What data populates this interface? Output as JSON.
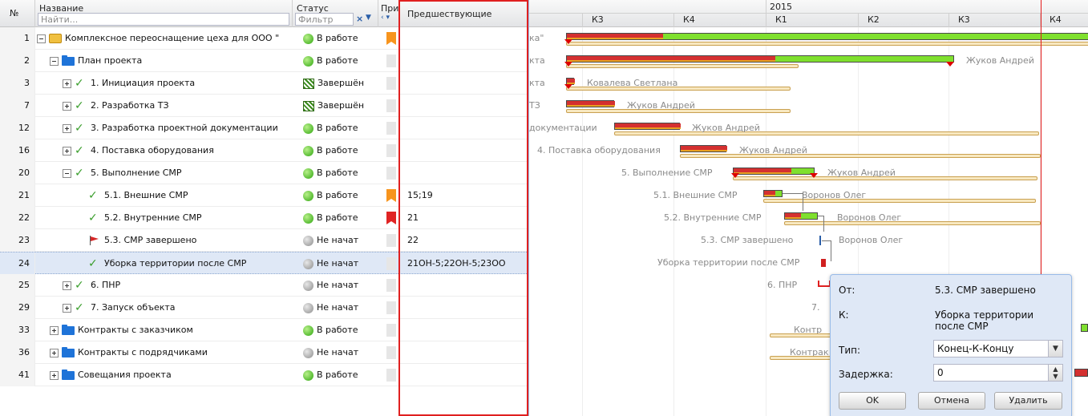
{
  "columns": {
    "num": "№",
    "name": "Название",
    "name_filter": "Найти...",
    "status": "Статус",
    "status_filter": "Фильтр",
    "priority": "При",
    "predecessors": "Предшествующие"
  },
  "timeline": {
    "year": "2015",
    "quarters": [
      "К3",
      "К4",
      "К1",
      "К2",
      "К3",
      "К4"
    ]
  },
  "rows": [
    {
      "num": "1",
      "name": "Комплексное переоснащение цеха для ООО \"",
      "status": "В работе",
      "pred": ""
    },
    {
      "num": "2",
      "name": "План проекта",
      "status": "В работе",
      "pred": ""
    },
    {
      "num": "3",
      "name": "1. Инициация проекта",
      "status": "Завершён",
      "pred": ""
    },
    {
      "num": "7",
      "name": "2. Разработка ТЗ",
      "status": "Завершён",
      "pred": ""
    },
    {
      "num": "12",
      "name": "3. Разработка проектной документации",
      "status": "В работе",
      "pred": ""
    },
    {
      "num": "16",
      "name": "4. Поставка оборудования",
      "status": "В работе",
      "pred": ""
    },
    {
      "num": "20",
      "name": "5. Выполнение СМР",
      "status": "В работе",
      "pred": ""
    },
    {
      "num": "21",
      "name": "5.1. Внешние СМР",
      "status": "В работе",
      "pred": "15;19"
    },
    {
      "num": "22",
      "name": "5.2. Внутренние СМР",
      "status": "В работе",
      "pred": "21"
    },
    {
      "num": "23",
      "name": "5.3. СМР завершено",
      "status": "Не начат",
      "pred": "22"
    },
    {
      "num": "24",
      "name": "Уборка территории после СМР",
      "status": "Не начат",
      "pred": "21ОН-5;22ОН-5;23ОО"
    },
    {
      "num": "25",
      "name": "6. ПНР",
      "status": "Не начат",
      "pred": ""
    },
    {
      "num": "29",
      "name": "7. Запуск объекта",
      "status": "Не начат",
      "pred": ""
    },
    {
      "num": "33",
      "name": "Контракты с заказчиком",
      "status": "В работе",
      "pred": ""
    },
    {
      "num": "36",
      "name": "Контракты с подрядчиками",
      "status": "Не начат",
      "pred": ""
    },
    {
      "num": "41",
      "name": "Совещания проекта",
      "status": "В работе",
      "pred": ""
    }
  ],
  "gantt_labels": {
    "r1_left": "ка\"",
    "r2_left": "кта",
    "r2_res": "Жуков Андрей",
    "r3_left": "кта",
    "r3_res": "Ковалева Светлана",
    "r7_left": "ТЗ",
    "r7_res": "Жуков Андрей",
    "r12_left": "документации",
    "r12_res": "Жуков Андрей",
    "r16_left": "4. Поставка оборудования",
    "r16_res": "Жуков Андрей",
    "r20_left": "5. Выполнение СМР",
    "r20_res": "Жуков Андрей",
    "r21_left": "5.1. Внешние СМР",
    "r21_res": "Воронов Олег",
    "r22_left": "5.2. Внутренние СМР",
    "r22_res": "Воронов Олег",
    "r23_left": "5.3. СМР завершено",
    "r23_res": "Воронов Олег",
    "r24_left": "Уборка территории после СМР",
    "r25_left": "6. ПНР",
    "r29_left": "7.",
    "r33_left": "Контр",
    "r36_left": "Контрак"
  },
  "popup": {
    "from_label": "От:",
    "from_value": "5.3. СМР завершено",
    "to_label": "К:",
    "to_value": "Уборка территории после СМР",
    "type_label": "Тип:",
    "type_value": "Конец-К-Концу",
    "delay_label": "Задержка:",
    "delay_value": "0",
    "ok": "OK",
    "cancel": "Отмена",
    "delete": "Удалить"
  }
}
